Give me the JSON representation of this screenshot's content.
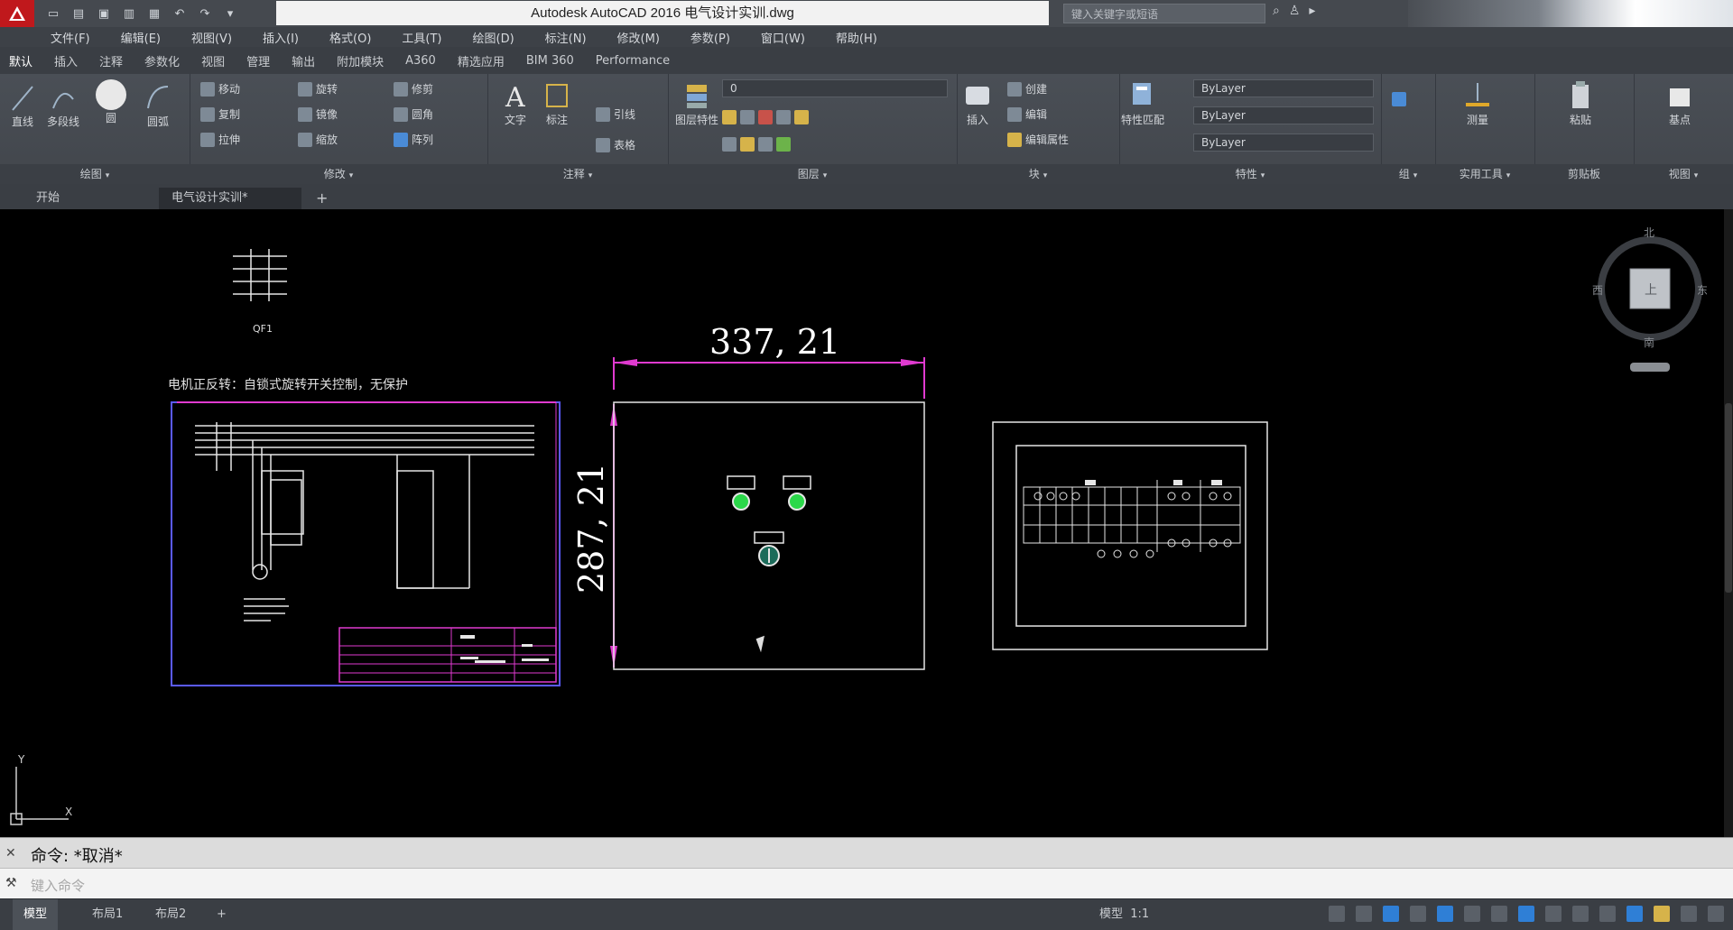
{
  "window": {
    "title": "Autodesk AutoCAD 2016    电气设计实训.dwg",
    "search_placeholder": "键入关键字或短语",
    "accent_color": "#c0181c"
  },
  "menu": [
    "文件(F)",
    "编辑(E)",
    "视图(V)",
    "插入(I)",
    "格式(O)",
    "工具(T)",
    "绘图(D)",
    "标注(N)",
    "修改(M)",
    "参数(P)",
    "窗口(W)",
    "帮助(H)"
  ],
  "ribbon_tabs": [
    "默认",
    "插入",
    "注释",
    "参数化",
    "视图",
    "管理",
    "输出",
    "附加模块",
    "A360",
    "精选应用",
    "BIM 360",
    "Performance"
  ],
  "ribbon": {
    "draw": {
      "title": "绘图",
      "line": "直线",
      "polyline": "多段线",
      "circle": "圆",
      "arc": "圆弧"
    },
    "modify": {
      "title": "修改",
      "move": "移动",
      "rotate": "旋转",
      "trim": "修剪",
      "copy": "复制",
      "mirror": "镜像",
      "fillet": "圆角",
      "stretch": "拉伸",
      "scale": "缩放",
      "array": "阵列"
    },
    "annotation": {
      "title": "注释",
      "text": "文字",
      "dimension": "标注",
      "leader": "引线",
      "table": "表格"
    },
    "layers": {
      "title": "图层",
      "layer_props": "图层特性",
      "current_layer": "0"
    },
    "block": {
      "title": "块",
      "insert": "插入",
      "create": "创建",
      "edit": "编辑",
      "edit_attr": "编辑属性"
    },
    "properties": {
      "title": "特性",
      "match": "特性匹配",
      "color": "ByLayer",
      "linetype": "ByLayer",
      "lineweight": "ByLayer"
    },
    "groups": {
      "title": "组"
    },
    "utilities": {
      "title": "实用工具",
      "measure": "测量"
    },
    "clipboard": {
      "title": "剪贴板",
      "paste": "粘贴"
    },
    "view": {
      "title": "视图",
      "base": "基点"
    }
  },
  "file_tabs": {
    "start": "开始",
    "active": "电气设计实训*",
    "plus": "+"
  },
  "drawing": {
    "qf_label": "QF1",
    "schematic_title": "电机正反转：自锁式旋转开关控制，无保护",
    "dim_horizontal": "337, 21",
    "dim_vertical": "287, 21",
    "viewcube": {
      "top": "上",
      "north": "北",
      "west": "西",
      "east": "东",
      "south": "南"
    },
    "ucs_x": "X",
    "ucs_y": "Y"
  },
  "command": {
    "history": "命令: *取消*",
    "prompt": "键入命令"
  },
  "status": {
    "tabs": [
      "模型",
      "布局1",
      "布局2"
    ],
    "model_label": "模型",
    "scale": "1:1"
  }
}
